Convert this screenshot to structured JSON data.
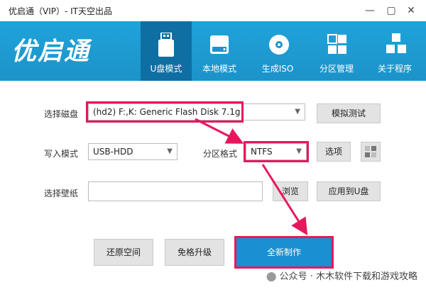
{
  "window": {
    "title": "优启通（VIP）- IT天空出品",
    "min": "—",
    "restore": "▢",
    "close": "✕"
  },
  "brand": {
    "logo_text": "优启通"
  },
  "tabs": [
    {
      "label": "U盘模式",
      "icon": "usb-drive-icon",
      "active": true
    },
    {
      "label": "本地模式",
      "icon": "hard-disk-icon",
      "active": false
    },
    {
      "label": "生成ISO",
      "icon": "disc-icon",
      "active": false
    },
    {
      "label": "分区管理",
      "icon": "grid-icon",
      "active": false
    },
    {
      "label": "关于程序",
      "icon": "cubes-icon",
      "active": false
    }
  ],
  "form": {
    "disk_label": "选择磁盘",
    "disk_value": "(hd2) F:,K: Generic Flash Disk 7.1g",
    "simulate_button": "模拟测试",
    "write_mode_label": "写入模式",
    "write_mode_value": "USB-HDD",
    "partition_label": "分区格式",
    "partition_value": "NTFS",
    "options_button": "选项",
    "wallpaper_label": "选择壁纸",
    "wallpaper_value": "",
    "browse_button": "浏览",
    "apply_button": "应用到U盘"
  },
  "actions": {
    "restore_space": "还原空间",
    "free_upgrade": "免格升级",
    "new_make": "全新制作"
  },
  "watermark": "公众号 · 木木软件下载和游戏攻略",
  "colors": {
    "ribbon": "#1fa3da",
    "active_tab": "#0f6fa3",
    "primary": "#1a8fd1",
    "highlight": "#e8175d"
  }
}
